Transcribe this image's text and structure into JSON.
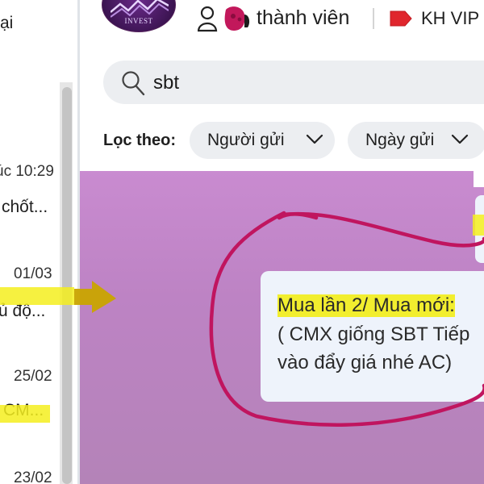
{
  "left_panel": {
    "items": [
      {
        "time": "úc 10:29",
        "preview": "chốt..."
      },
      {
        "time": "01/03",
        "preview": "ủ độ..."
      },
      {
        "time": "25/02",
        "preview": "CM..."
      },
      {
        "time": "23/02",
        "preview": ""
      }
    ],
    "top_fragment": "ại"
  },
  "header": {
    "avatar_logo_text": "INVEST",
    "members_icon": "person-outline-icon",
    "members_label": "thành viên",
    "vip_icon": "red-tag-icon",
    "vip_label": "KH VIP"
  },
  "search": {
    "icon": "search-icon",
    "value": "sbt"
  },
  "filters": {
    "label": "Lọc theo:",
    "chips": [
      {
        "label": "Người gửi",
        "icon": "chevron-down-icon"
      },
      {
        "label": "Ngày gửi",
        "icon": "chevron-down-icon"
      }
    ]
  },
  "preview_message": {
    "line1": "Mua lần 2/ Mua mới:",
    "line2": "( CMX giống SBT Tiếp",
    "line3": "vào đẩy giá nhé AC)"
  },
  "colors": {
    "preview_bg": "#c98bd0",
    "annotation_circle": "#c0155f",
    "highlight": "#f4ee1f",
    "tag_red": "#e0262d"
  }
}
